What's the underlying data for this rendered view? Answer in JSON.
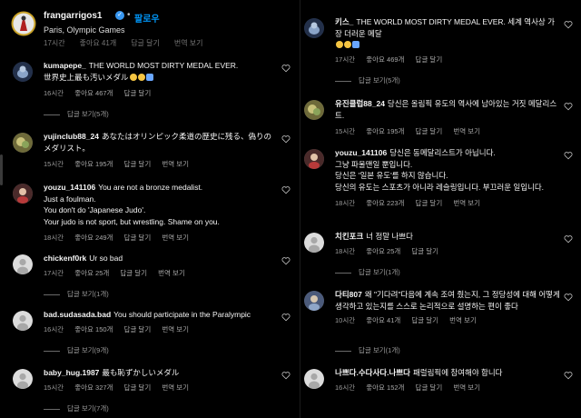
{
  "post": {
    "username": "frangarrigos1",
    "verified_mark": "✓",
    "separator": "•",
    "follow_label": "팔로우",
    "location": "Paris, Olympic Games",
    "ghost_time": "17시간",
    "ghost_likes": "좋아요 41개",
    "ghost_reply": "답글 달기",
    "ghost_translate": "번역 보기"
  },
  "left_comments": [
    {
      "user": "kumapepe_",
      "text": "THE WORLD MOST DIRTY MEDAL EVER.\n世界史上最も汚いメダル",
      "time": "16시간",
      "likes": "좋아요 467개",
      "reply": "답글 달기",
      "translate": "",
      "view_replies": "답글 보기(5개)"
    },
    {
      "user": "yujinclub88_24",
      "text": "あなたはオリンピック柔道の歴史に残る、偽りのメダリスト。",
      "time": "15시간",
      "likes": "좋아요 195개",
      "reply": "답글 달기",
      "translate": "번역 보기",
      "view_replies": ""
    },
    {
      "user": "youzu_141106",
      "text": "You are not a bronze medalist.\nJust a foulman.\nYou don't do 'Japanese Judo'.\nYour judo is not sport, but wrestling. Shame on you.",
      "time": "18시간",
      "likes": "좋아요 249개",
      "reply": "답글 달기",
      "translate": "번역 보기",
      "view_replies": ""
    },
    {
      "user": "chickenf0rk",
      "text": "Ur so bad",
      "time": "17시간",
      "likes": "좋아요 25개",
      "reply": "답글 달기",
      "translate": "번역 보기",
      "view_replies": "답글 보기(1개)"
    },
    {
      "user": "bad.sudasada.bad",
      "text": "You should participate in the Paralympic",
      "time": "16시간",
      "likes": "좋아요 150개",
      "reply": "답글 달기",
      "translate": "번역 보기",
      "view_replies": "답글 보기(9개)"
    },
    {
      "user": "baby_hug.1987",
      "text": "最も恥ずかしいメダル",
      "time": "15시간",
      "likes": "좋아요 327개",
      "reply": "답글 달기",
      "translate": "번역 보기",
      "view_replies": "답글 보기(7개)"
    }
  ],
  "right_comments": [
    {
      "user": "키스_",
      "text": "THE WORLD MOST DIRTY MEDAL EVER. 세계 역사상 가장 더러운 메달",
      "time": "17시간",
      "likes": "좋아요 469개",
      "reply": "답글 달기",
      "translate": "",
      "view_replies": "답글 보기(5개)"
    },
    {
      "user": "유진클럽88_24",
      "text": "당신은 올림픽 유도의 역사에 남아있는 거짓 메달리스트.",
      "time": "15시간",
      "likes": "좋아요 195개",
      "reply": "답글 달기",
      "translate": "번역 보기",
      "view_replies": ""
    },
    {
      "user": "youzu_141106",
      "text": "당신은 동메달리스트가 아닙니다.\n그냥 파울맨일 뿐입니다.\n당신은 '일본 유도'를 하지 않습니다.\n당신의 유도는 스포츠가 아니라 레슬링입니다. 부끄러운 일입니다.",
      "time": "18시간",
      "likes": "좋아요 223개",
      "reply": "답글 달기",
      "translate": "번역 보기",
      "view_replies": ""
    },
    {
      "user": "치킨포크",
      "text": "너 정말 나쁘다",
      "time": "18시간",
      "likes": "좋아요 25개",
      "reply": "답글 달기",
      "translate": "",
      "view_replies": "답글 보기(1개)"
    },
    {
      "user": "다티807",
      "text": "왜 \"기다려\"다음에 계속 조여 줬는지, 그 정당성에 대해 어떻게 생각하고 있는지를 스스로 논리적으로 설명하는 편이 좋다",
      "time": "10시간",
      "likes": "좋아요 41개",
      "reply": "답글 달기",
      "translate": "번역 보기",
      "view_replies": "답글 보기(1개)"
    },
    {
      "user": "나쁘다.수다사다.나쁘다",
      "text": "패럴림픽에 참여해야 합니다",
      "time": "16시간",
      "likes": "좋아요 152개",
      "reply": "답글 달기",
      "translate": "번역 보기",
      "view_replies": ""
    }
  ],
  "colors": {
    "background": "#000000",
    "follow": "#0095f6",
    "verified": "#3897f0",
    "muted": "#9a9a9a",
    "emoji": "#f5c542",
    "emoji_blue": "#6aa7ff"
  },
  "icons": {
    "heart": "heart-outline-icon",
    "verified": "verified-badge-icon"
  }
}
